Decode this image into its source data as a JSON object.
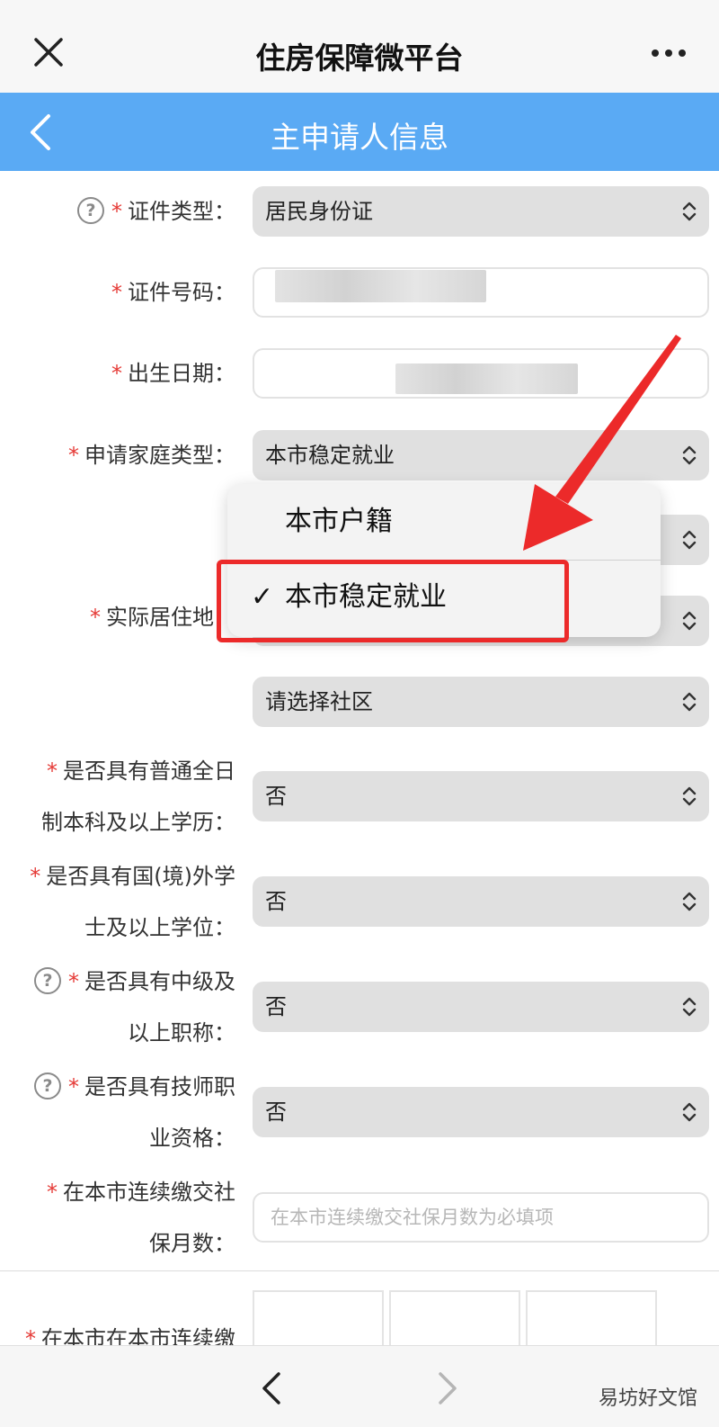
{
  "app_title": "住房保障微平台",
  "header": {
    "title": "主申请人信息"
  },
  "form": {
    "id_type": {
      "label": "证件类型：",
      "value": "居民身份证"
    },
    "id_number": {
      "label": "证件号码："
    },
    "birth_date": {
      "label": "出生日期："
    },
    "family_type": {
      "label": "申请家庭类型：",
      "value": "本市稳定就业"
    },
    "residence": {
      "label": "实际居住地：",
      "community_placeholder": "请选择社区"
    },
    "bachelor": {
      "label_line1": "是否具有普通全日",
      "label_line2": "制本科及以上学历：",
      "value": "否"
    },
    "overseas_degree": {
      "label_line1": "是否具有国(境)外学",
      "label_line2": "士及以上学位：",
      "value": "否"
    },
    "mid_title": {
      "label_line1": "是否具有中级及",
      "label_line2": "以上职称：",
      "value": "否"
    },
    "technician": {
      "label_line1": "是否具有技师职",
      "label_line2": "业资格：",
      "value": "否"
    },
    "social_security": {
      "label_line1": "在本市连续缴交社",
      "label_line2": "保月数：",
      "placeholder": "在本市连续缴交社保月数为必填项"
    },
    "partial_label": "在本市在本市连续缴"
  },
  "dropdown": {
    "options": [
      "本市户籍",
      "本市稳定就业"
    ],
    "selected": "本市稳定就业",
    "check_mark": "✓"
  },
  "required_mark": "*",
  "help_mark": "?",
  "watermark": "易坊好文馆",
  "colors": {
    "header_bg": "#5aaaf4",
    "required": "#e53935",
    "highlight": "#ec2a2a"
  }
}
